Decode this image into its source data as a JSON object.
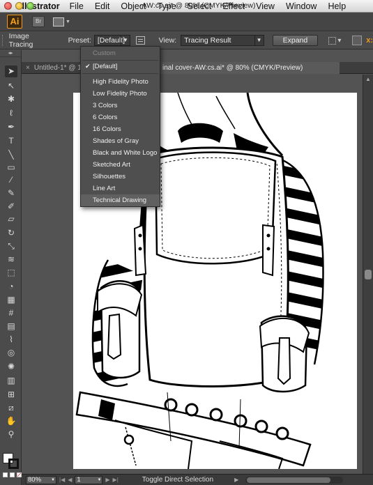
{
  "menubar": {
    "app_name": "Illustrator",
    "items": [
      "File",
      "Edit",
      "Object",
      "Type",
      "Select",
      "Effect",
      "View",
      "Window",
      "Help"
    ]
  },
  "appbar": {
    "logo": "Ai",
    "bridge": "Br"
  },
  "controlbar": {
    "label": "Image Tracing",
    "preset_label": "Preset:",
    "preset_value": "[Default]",
    "view_label": "View:",
    "view_value": "Tracing Result",
    "expand_label": "Expand"
  },
  "preset_menu": {
    "items": [
      {
        "label": "Custom",
        "state": "disabled"
      },
      {
        "label": "[Default]",
        "state": "checked"
      },
      {
        "label": "High Fidelity Photo",
        "state": "normal"
      },
      {
        "label": "Low Fidelity Photo",
        "state": "normal"
      },
      {
        "label": "3 Colors",
        "state": "normal"
      },
      {
        "label": "6 Colors",
        "state": "normal"
      },
      {
        "label": "16 Colors",
        "state": "normal"
      },
      {
        "label": "Shades of Gray",
        "state": "normal"
      },
      {
        "label": "Black and White Logo",
        "state": "normal"
      },
      {
        "label": "Sketched Art",
        "state": "normal"
      },
      {
        "label": "Silhouettes",
        "state": "normal"
      },
      {
        "label": "Line Art",
        "state": "normal"
      },
      {
        "label": "Technical Drawing",
        "state": "highlighted"
      }
    ]
  },
  "documents": {
    "back_window_title": "-AW:cs.ai* @ 80% (CMYK/Preview)",
    "tab1_title": "Untitled-1* @ 10",
    "tab2_title": "inal cover-AW:cs.ai* @ 80% (CMYK/Preview)"
  },
  "statusbar": {
    "zoom": "80%",
    "page": "1",
    "status_text": "Toggle Direct Selection"
  },
  "colors": {
    "accent": "#f39a1d",
    "panel_bg": "#4a4a4a",
    "canvas_bg": "#535353",
    "artboard": "#ffffff"
  }
}
